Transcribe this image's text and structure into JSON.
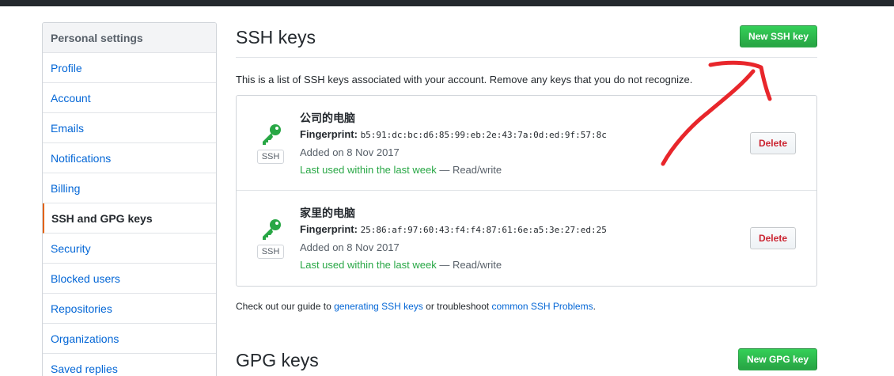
{
  "sidebar": {
    "header": "Personal settings",
    "items": [
      {
        "label": "Profile"
      },
      {
        "label": "Account"
      },
      {
        "label": "Emails"
      },
      {
        "label": "Notifications"
      },
      {
        "label": "Billing"
      },
      {
        "label": "SSH and GPG keys"
      },
      {
        "label": "Security"
      },
      {
        "label": "Blocked users"
      },
      {
        "label": "Repositories"
      },
      {
        "label": "Organizations"
      },
      {
        "label": "Saved replies"
      }
    ],
    "selected": "SSH and GPG keys"
  },
  "ssh": {
    "title": "SSH keys",
    "new_button": "New SSH key",
    "description": "This is a list of SSH keys associated with your account. Remove any keys that you do not recognize.",
    "keys": [
      {
        "title": "公司的电脑",
        "fingerprint_label": "Fingerprint:",
        "fingerprint": "b5:91:dc:bc:d6:85:99:eb:2e:43:7a:0d:ed:9f:57:8c",
        "added": "Added on 8 Nov 2017",
        "last_used": "Last used within the last week",
        "access": " — Read/write",
        "badge": "SSH",
        "delete_label": "Delete"
      },
      {
        "title": "家里的电脑",
        "fingerprint_label": "Fingerprint:",
        "fingerprint": "25:86:af:97:60:43:f4:f4:87:61:6e:a5:3e:27:ed:25",
        "added": "Added on 8 Nov 2017",
        "last_used": "Last used within the last week",
        "access": " — Read/write",
        "badge": "SSH",
        "delete_label": "Delete"
      }
    ],
    "footer": {
      "prefix": "Check out our guide to ",
      "link1": "generating SSH keys",
      "middle": " or troubleshoot ",
      "link2": "common SSH Problems",
      "suffix": "."
    }
  },
  "gpg": {
    "title": "GPG keys",
    "new_button": "New GPG key"
  },
  "colors": {
    "accent_green": "#28a745",
    "link_blue": "#0366d6",
    "danger_red": "#cb2431",
    "annotation_red": "#e8262b"
  },
  "icons": {
    "key": "key-icon"
  }
}
